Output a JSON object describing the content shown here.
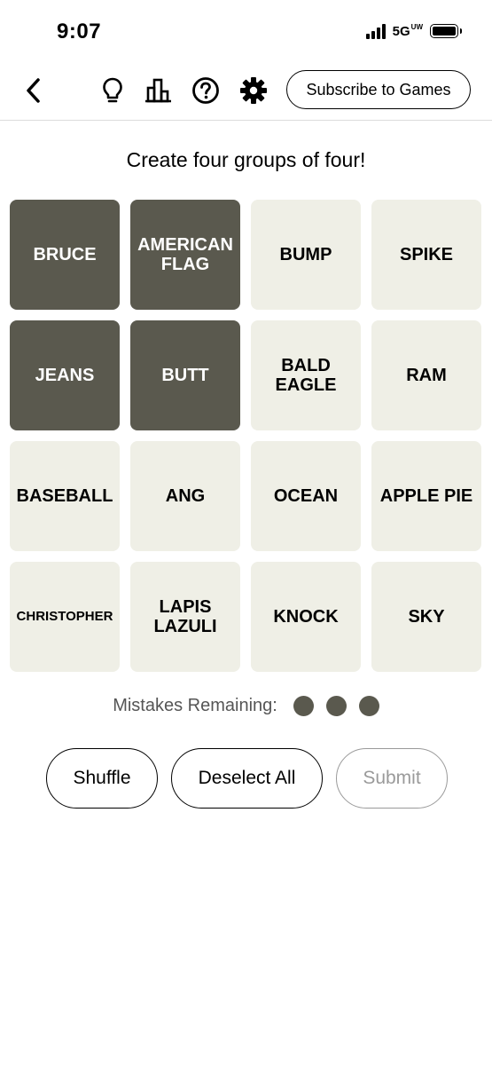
{
  "status_bar": {
    "time": "9:07",
    "network": "5G",
    "network_suffix": "UW"
  },
  "toolbar": {
    "back_icon": "chevron-left-icon",
    "hint_icon": "lightbulb-icon",
    "stats_icon": "bar-chart-icon",
    "help_icon": "question-circle-icon",
    "settings_icon": "gear-icon",
    "subscribe_label": "Subscribe to Games"
  },
  "instructions": "Create four groups of four!",
  "tiles": [
    {
      "label": "BRUCE",
      "selected": true
    },
    {
      "label": "AMERICAN\nFLAG",
      "selected": true
    },
    {
      "label": "BUMP",
      "selected": false
    },
    {
      "label": "SPIKE",
      "selected": false
    },
    {
      "label": "JEANS",
      "selected": true
    },
    {
      "label": "BUTT",
      "selected": true
    },
    {
      "label": "BALD\nEAGLE",
      "selected": false
    },
    {
      "label": "RAM",
      "selected": false
    },
    {
      "label": "BASEBALL",
      "selected": false
    },
    {
      "label": "ANG",
      "selected": false
    },
    {
      "label": "OCEAN",
      "selected": false
    },
    {
      "label": "APPLE PIE",
      "selected": false
    },
    {
      "label": "CHRISTOPHER",
      "selected": false
    },
    {
      "label": "LAPIS\nLAZULI",
      "selected": false
    },
    {
      "label": "KNOCK",
      "selected": false
    },
    {
      "label": "SKY",
      "selected": false
    }
  ],
  "mistakes": {
    "label": "Mistakes Remaining:",
    "remaining": 3
  },
  "actions": {
    "shuffle_label": "Shuffle",
    "deselect_label": "Deselect All",
    "submit_label": "Submit"
  },
  "colors": {
    "selected_tile": "#5a594e",
    "tile": "#efefe6",
    "disabled": "#9a9a9a"
  }
}
